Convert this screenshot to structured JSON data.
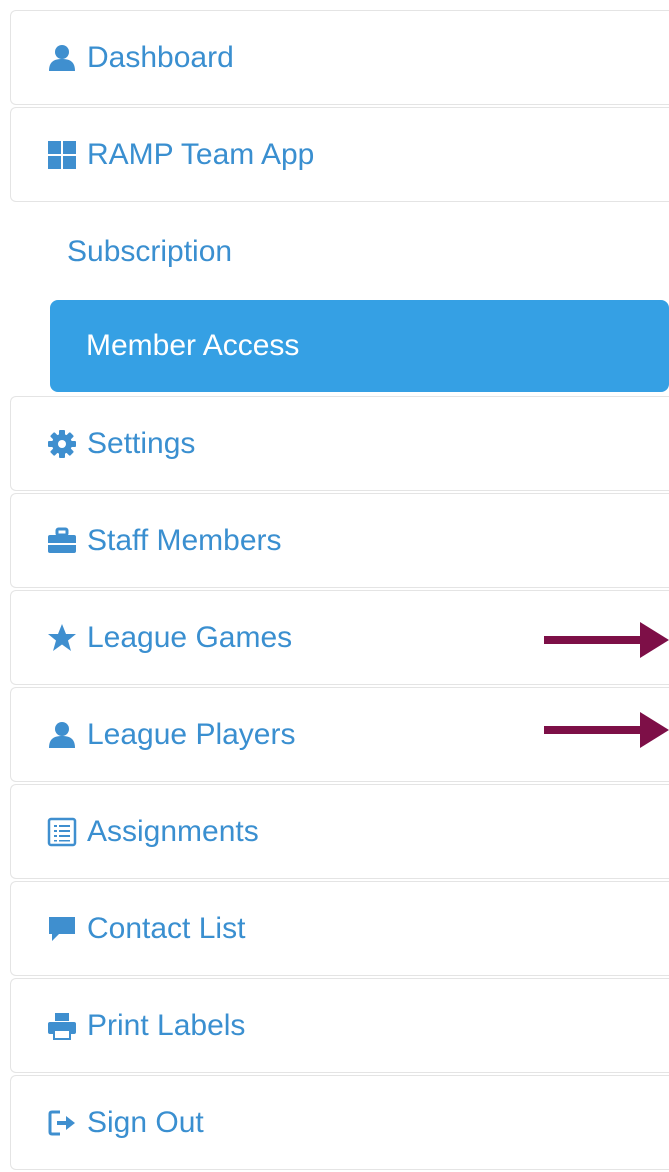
{
  "menu": {
    "items": [
      {
        "label": "Dashboard",
        "icon": "user-icon"
      },
      {
        "label": "RAMP Team App",
        "icon": "grid-icon"
      },
      {
        "label": "Settings",
        "icon": "gear-icon"
      },
      {
        "label": "Staff Members",
        "icon": "briefcase-icon"
      },
      {
        "label": "League Games",
        "icon": "star-icon"
      },
      {
        "label": "League Players",
        "icon": "user-icon"
      },
      {
        "label": "Assignments",
        "icon": "list-icon"
      },
      {
        "label": "Contact List",
        "icon": "chat-icon"
      },
      {
        "label": "Print Labels",
        "icon": "printer-icon"
      },
      {
        "label": "Sign Out",
        "icon": "sign-out-icon"
      }
    ],
    "submenu": {
      "subscription_label": "Subscription",
      "member_access_label": "Member Access"
    }
  },
  "colors": {
    "link": "#3a8fd0",
    "icon": "#3f8fcf",
    "active_bg": "#35a0e4",
    "active_text": "#ffffff",
    "arrow": "#7d0f47"
  }
}
